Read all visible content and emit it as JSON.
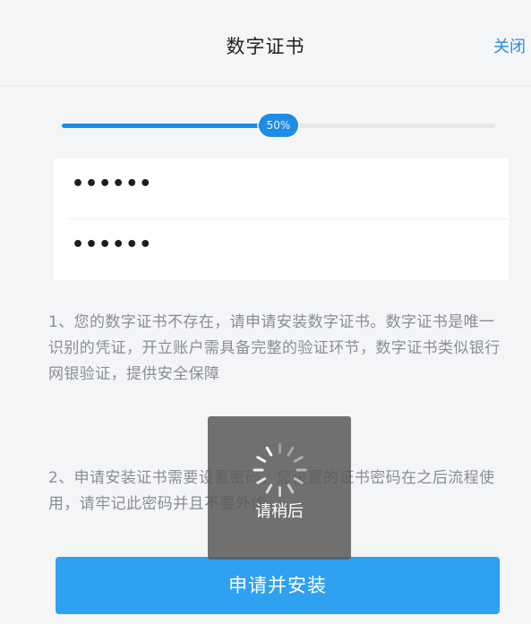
{
  "header": {
    "title": "数字证书",
    "close_label": "关闭"
  },
  "progress": {
    "value": 0.5,
    "label": "50%"
  },
  "password_fields": [
    {
      "value": "••••••"
    },
    {
      "value": "••••••"
    }
  ],
  "notes": [
    "1、您的数字证书不存在，请申请安装数字证书。数字证书是唯一识别的凭证，开立账户需具备完整的验证环节，数字证书类似银行网银验证，提供安全保障",
    "2、申请安装证书需要设置密码，您设置的证书密码在之后流程使用，请牢记此密码并且不要外传。"
  ],
  "loading": {
    "text": "请稍后"
  },
  "submit_label": "申请并安装",
  "colors": {
    "accent": "#1f8ce6",
    "button": "#2ea1f0",
    "close": "#2a8ae0"
  }
}
